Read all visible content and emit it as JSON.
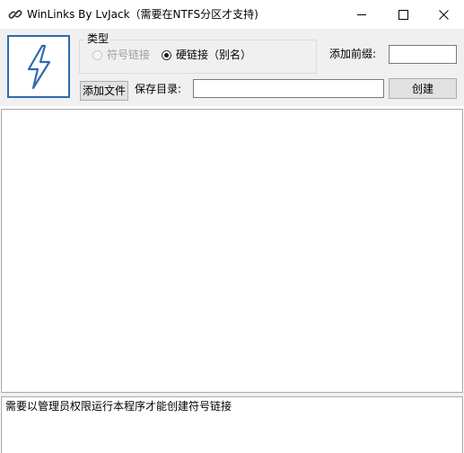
{
  "window": {
    "title": "WinLinks By LvJack（需要在NTFS分区才支持)",
    "icon": "link-icon",
    "controls": {
      "minimize_icon": "minimize-icon",
      "maximize_icon": "maximize-icon",
      "close_icon": "close-icon"
    }
  },
  "logo": {
    "icon": "lightning-icon",
    "border_color": "#2e6bb0"
  },
  "link_type": {
    "label": "类型",
    "options": [
      {
        "label": "符号链接",
        "checked": false,
        "enabled": false
      },
      {
        "label": "硬链接（别名）",
        "checked": true,
        "enabled": true
      }
    ]
  },
  "prefix": {
    "label": "添加前缀:",
    "value": "",
    "placeholder": ""
  },
  "add_file": {
    "label": "添加文件"
  },
  "save_dir": {
    "label": "保存目录:",
    "value": "",
    "placeholder": ""
  },
  "create": {
    "label": "创建"
  },
  "file_list": {
    "items": []
  },
  "log": {
    "text": "需要以管理员权限运行本程序才能创建符号链接"
  }
}
